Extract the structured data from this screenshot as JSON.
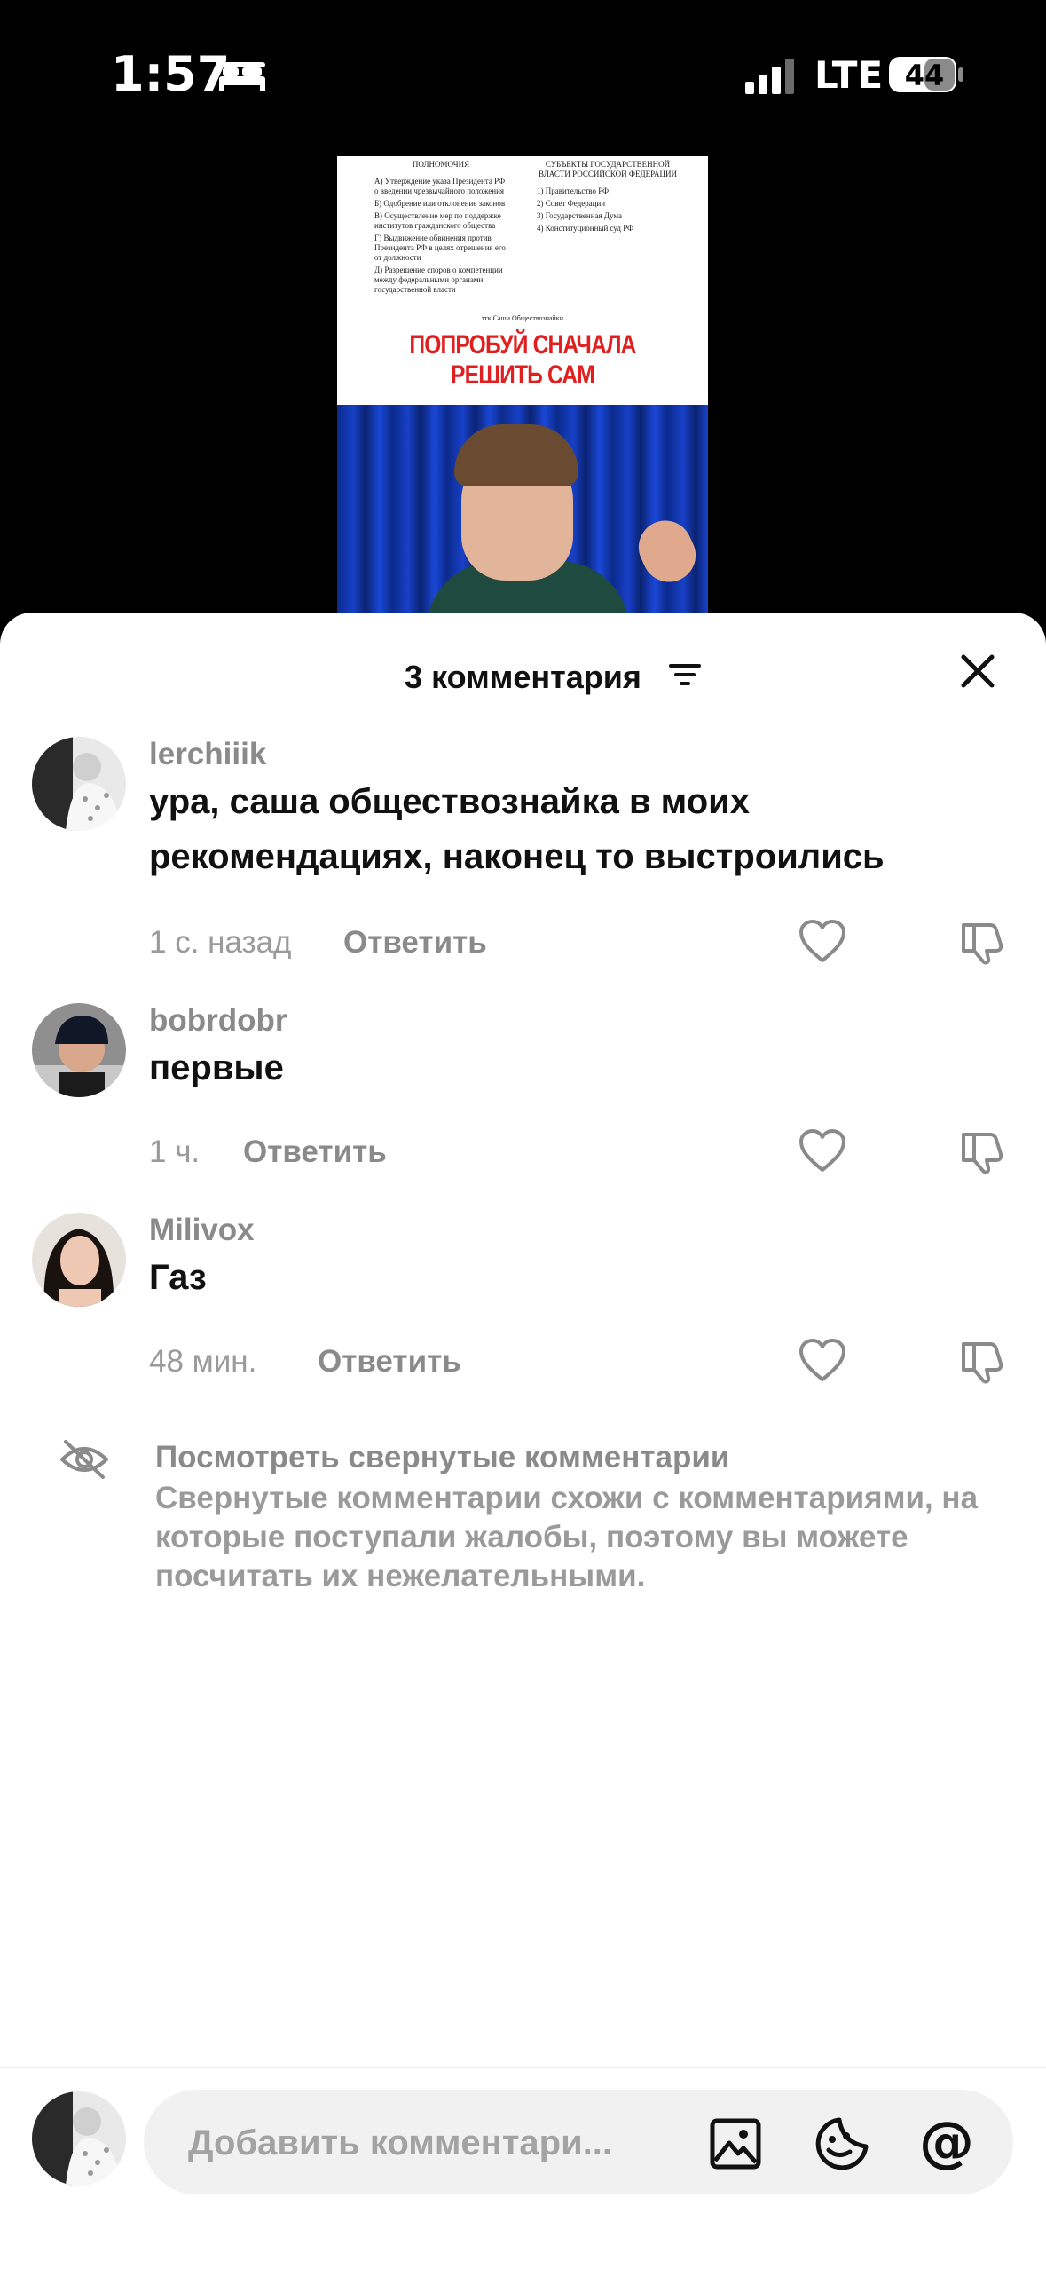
{
  "status_bar": {
    "time": "1:57",
    "network": "LTE",
    "battery": "44"
  },
  "video": {
    "doc_col1_title": "ПОЛНОМОЧИЯ",
    "doc_col1_items": [
      "А) Утверждение указа Президента РФ о введении чрезвычайного положения",
      "Б) Одобрение или отклонение законов",
      "В) Осуществление мер по поддержке институтов гражданского общества",
      "Г) Выдвижение обвинения против Президента РФ в целях отрешения его от должности",
      "Д) Разрешение споров о компетенции между федеральными органами государственной власти"
    ],
    "doc_col2_title": "СУБЪЕКТЫ ГОСУДАРСТВЕННОЙ ВЛАСТИ РОССИЙСКОЙ ФЕДЕРАЦИИ",
    "doc_col2_items": [
      "1) Правительство РФ",
      "2) Совет Федерации",
      "3) Государственная Дума",
      "4) Конституционный суд РФ"
    ],
    "credit": "тгк Саши Обществознайки",
    "banner": "ПОПРОБУЙ СНАЧАЛА РЕШИТЬ САМ"
  },
  "comments_sheet": {
    "title": "3 комментария",
    "comments": [
      {
        "username": "lerchiiik",
        "text": "ура, саша обществознайка в моих рекомендациях, наконец то выстроились",
        "time": "1 с. назад",
        "reply": "Ответить"
      },
      {
        "username": "bobrdobr",
        "text": "первые",
        "time": "1 ч.",
        "reply": "Ответить"
      },
      {
        "username": "Milivox",
        "text": "Газ",
        "time": "48 мин.",
        "reply": "Ответить"
      }
    ],
    "hidden": {
      "title": "Посмотреть свернутые комментарии",
      "description": "Свернутые комментарии схожи с комментариями, на которые поступали жалобы, поэтому вы можете посчитать их нежелательными."
    },
    "input": {
      "placeholder": "Добавить комментари..."
    },
    "at_symbol": "@"
  }
}
